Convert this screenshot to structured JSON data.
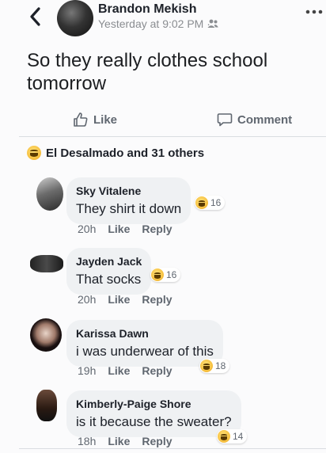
{
  "post": {
    "author": "Brandon Mekish",
    "time": "Yesterday at 9:02 PM ·",
    "text": "So they really clothes school tomorrow"
  },
  "actions": {
    "like": "Like",
    "comment": "Comment"
  },
  "reactions_summary": "El Desalmado and 31 others",
  "comments": [
    {
      "name": "Sky Vitalene",
      "text": "They shirt it down",
      "age": "20h",
      "like": "Like",
      "reply": "Reply",
      "reactions": "16"
    },
    {
      "name": "Jayden Jack",
      "text": "That socks",
      "age": "20h",
      "like": "Like",
      "reply": "Reply",
      "reactions": "16"
    },
    {
      "name": "Karissa Dawn",
      "text": "i was underwear of this",
      "age": "19h",
      "like": "Like",
      "reply": "Reply",
      "reactions": "18"
    },
    {
      "name": "Kimberly-Paige Shore",
      "text": "is it because the sweater?",
      "age": "18h",
      "like": "Like",
      "reply": "Reply",
      "reactions": "14"
    }
  ],
  "icons": {
    "back": "chevron-left-icon",
    "more": "more-icon",
    "audience": "friends-icon",
    "like": "thumbs-up-icon",
    "comment": "comment-icon",
    "reaction": "haha-icon"
  }
}
